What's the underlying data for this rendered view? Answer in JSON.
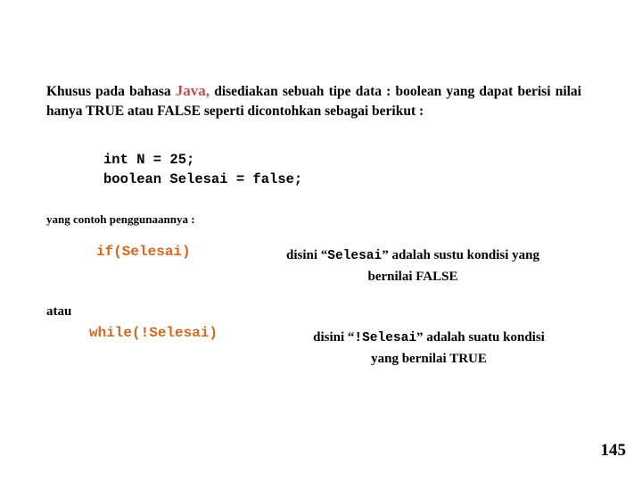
{
  "slide": {
    "intro": {
      "before_java": "Khusus pada bahasa ",
      "java_word": "Java,",
      "after_java": " disediakan sebuah tipe data : boolean yang dapat berisi nilai hanya TRUE atau FALSE seperti dicontohkan sebagai berikut :"
    },
    "code_block": "int N = 25;\nboolean Selesai = false;",
    "note": "yang contoh penggunaannya :",
    "if_section": {
      "code": "if(Selesai)",
      "description_line1_a": "disini “",
      "description_line1_mono": "Selesai",
      "description_line1_b": "” adalah sustu kondisi yang",
      "description_line2": "bernilai  FALSE"
    },
    "atau": "atau",
    "while_section": {
      "code": "while(!Selesai)",
      "description_line1_a": "disini “",
      "description_line1_mono": "!Selesai",
      "description_line1_b": "” adalah suatu  kondisi",
      "description_line2": "yang  bernilai TRUE"
    },
    "page_number": "145"
  }
}
